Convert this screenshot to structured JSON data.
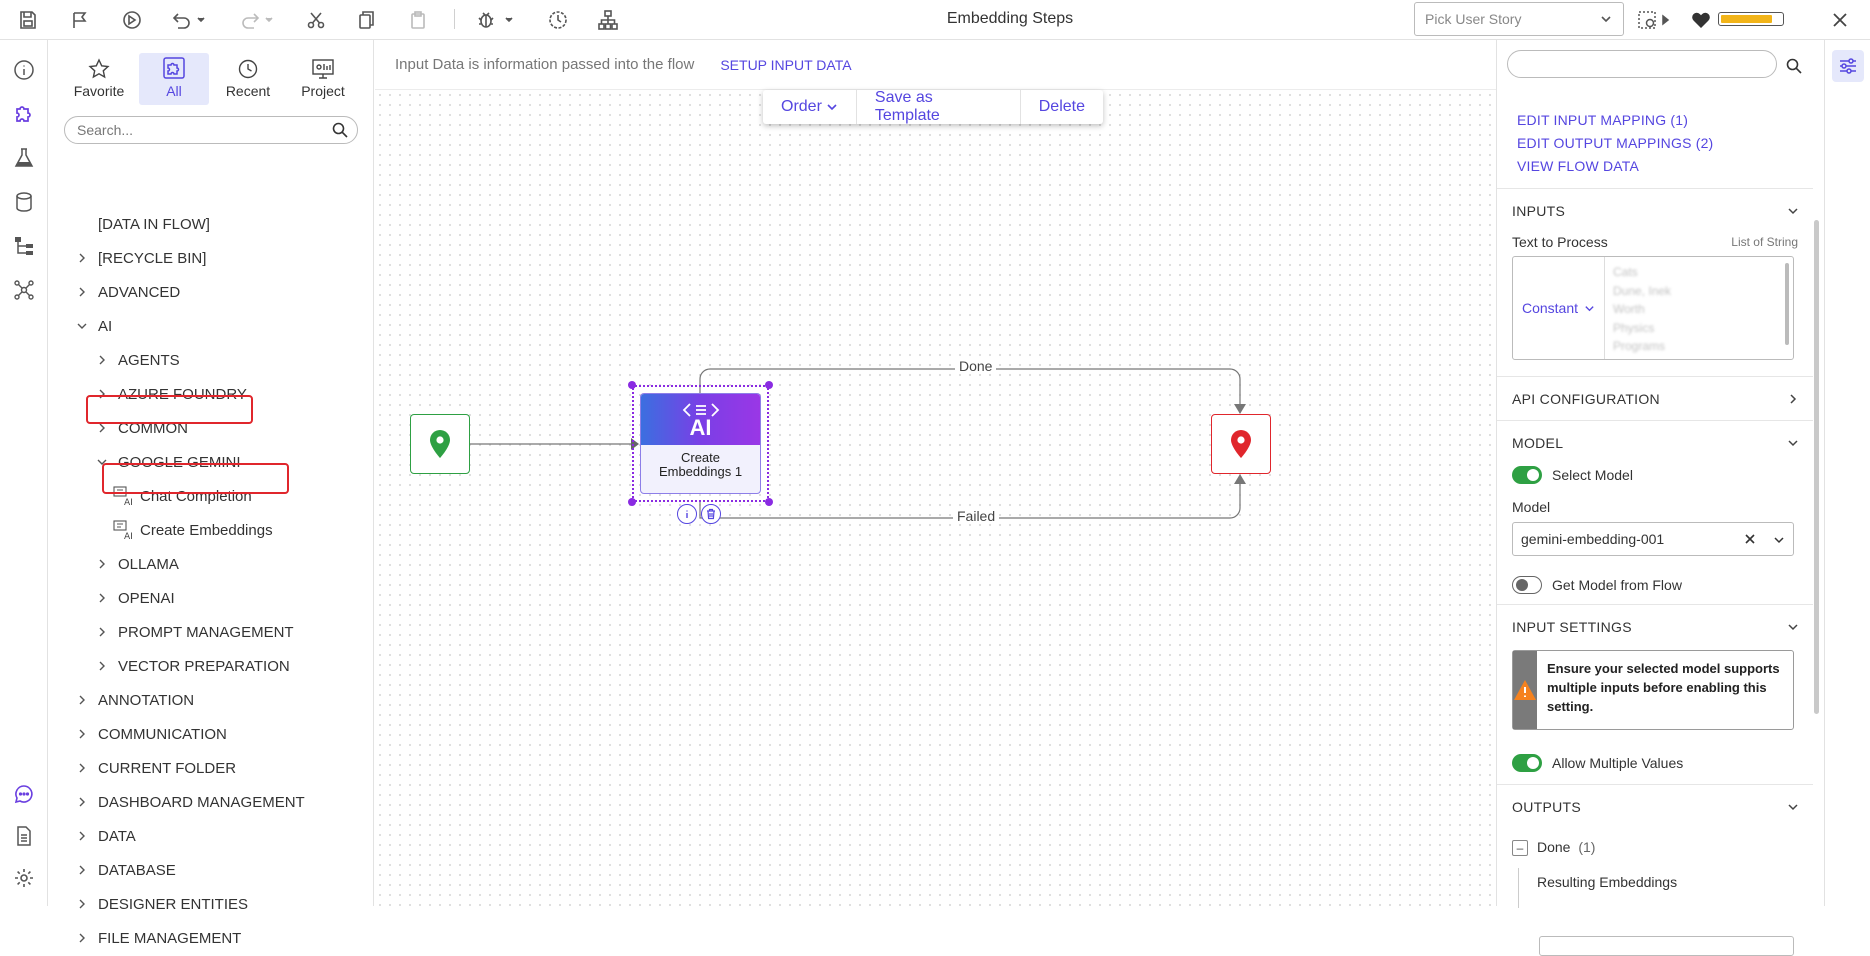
{
  "app": {
    "title": "Embedding Steps"
  },
  "topbar": {
    "story_placeholder": "Pick User Story",
    "health_percent": 85
  },
  "toolbox": {
    "tabs": [
      {
        "label": "Favorite",
        "icon": "star-icon"
      },
      {
        "label": "All",
        "icon": "puzzle-icon",
        "active": true
      },
      {
        "label": "Recent",
        "icon": "clock-icon"
      },
      {
        "label": "Project",
        "icon": "project-icon"
      }
    ],
    "search_placeholder": "Search...",
    "tree": [
      {
        "label": "[DATA IN FLOW]",
        "level": 0,
        "chevron": "none"
      },
      {
        "label": "[RECYCLE BIN]",
        "level": 0,
        "chevron": "right"
      },
      {
        "label": "ADVANCED",
        "level": 0,
        "chevron": "right"
      },
      {
        "label": "AI",
        "level": 0,
        "chevron": "down"
      },
      {
        "label": "AGENTS",
        "level": 1,
        "chevron": "right"
      },
      {
        "label": "AZURE FOUNDRY",
        "level": 1,
        "chevron": "right"
      },
      {
        "label": "COMMON",
        "level": 1,
        "chevron": "right"
      },
      {
        "label": "GOOGLE GEMINI",
        "level": 1,
        "chevron": "down",
        "highlighted": true
      },
      {
        "label": "Chat Completion",
        "level": 2,
        "chevron": "leaf",
        "icon": "ai-chat-icon"
      },
      {
        "label": "Create Embeddings",
        "level": 2,
        "chevron": "leaf",
        "icon": "ai-embed-icon",
        "highlighted": true
      },
      {
        "label": "OLLAMA",
        "level": 1,
        "chevron": "right"
      },
      {
        "label": "OPENAI",
        "level": 1,
        "chevron": "right"
      },
      {
        "label": "PROMPT MANAGEMENT",
        "level": 1,
        "chevron": "right"
      },
      {
        "label": "VECTOR PREPARATION",
        "level": 1,
        "chevron": "right"
      },
      {
        "label": "ANNOTATION",
        "level": 0,
        "chevron": "right"
      },
      {
        "label": "COMMUNICATION",
        "level": 0,
        "chevron": "right"
      },
      {
        "label": "CURRENT FOLDER",
        "level": 0,
        "chevron": "right"
      },
      {
        "label": "DASHBOARD MANAGEMENT",
        "level": 0,
        "chevron": "right"
      },
      {
        "label": "DATA",
        "level": 0,
        "chevron": "right"
      },
      {
        "label": "DATABASE",
        "level": 0,
        "chevron": "right"
      },
      {
        "label": "DESIGNER ENTITIES",
        "level": 0,
        "chevron": "right"
      },
      {
        "label": "FILE MANAGEMENT",
        "level": 0,
        "chevron": "right"
      }
    ]
  },
  "canvas": {
    "info_text": "Input Data is information passed into the flow",
    "setup_link": "SETUP INPUT DATA",
    "ctx_menu": {
      "order": "Order",
      "save_template": "Save as Template",
      "delete": "Delete"
    },
    "step": {
      "icon_text": "AI",
      "label_line1": "Create",
      "label_line2": "Embeddings 1"
    },
    "edges": {
      "done": "Done",
      "failed": "Failed"
    }
  },
  "props": {
    "links": [
      "EDIT INPUT MAPPING (1)",
      "EDIT OUTPUT MAPPINGS (2)",
      "VIEW FLOW DATA"
    ],
    "inputs": {
      "title": "INPUTS",
      "field_label": "Text to Process",
      "field_type": "List of String",
      "mode": "Constant",
      "values": [
        "Cats",
        "Dune, Inek",
        "Worth",
        "Physics",
        "Programs"
      ]
    },
    "api_config": {
      "title": "API CONFIGURATION"
    },
    "model": {
      "title": "MODEL",
      "select_model_label": "Select Model",
      "select_model_on": true,
      "model_label": "Model",
      "model_value": "gemini-embedding-001",
      "from_flow_label": "Get Model from Flow",
      "from_flow_on": false
    },
    "input_settings": {
      "title": "INPUT SETTINGS",
      "warning": "Ensure your selected model supports multiple inputs before enabling this setting.",
      "allow_multiple_label": "Allow Multiple Values",
      "allow_multiple_on": true
    },
    "outputs": {
      "title": "OUTPUTS",
      "done_label": "Done",
      "done_count": "(1)",
      "resulting_label": "Resulting Embeddings"
    }
  },
  "colors": {
    "accent": "#5546e0",
    "success": "#2ea043",
    "danger": "#e0262c",
    "warning": "#f2b418"
  }
}
